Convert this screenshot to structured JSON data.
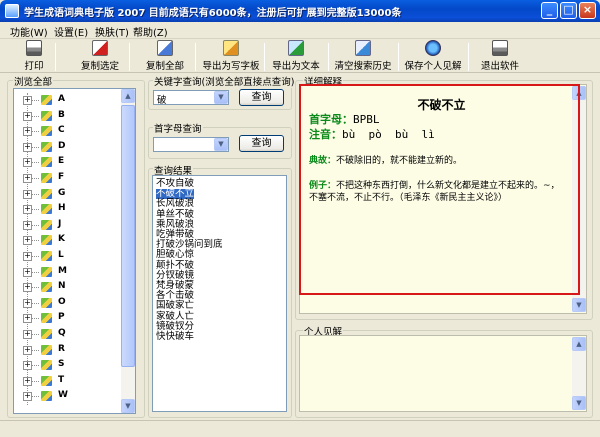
{
  "window": {
    "title": "学生成语词典电子版 2007 目前成语只有6000条，注册后可扩展到完整版13000条"
  },
  "menu": [
    "功能(W)",
    "设置(E)",
    "换肤(T)",
    "帮助(Z)"
  ],
  "toolbar": {
    "print": "打印",
    "copy_selected": "复制选定",
    "copy_all": "复制全部",
    "export_writer": "导出为写字板",
    "export_text": "导出为文本",
    "clear_history": "清空搜索历史",
    "save_opinion": "保存个人见解",
    "exit": "退出软件"
  },
  "browse": {
    "label": "浏览全部",
    "letters": [
      "A",
      "B",
      "C",
      "D",
      "E",
      "F",
      "G",
      "H",
      "J",
      "K",
      "L",
      "M",
      "N",
      "O",
      "P",
      "Q",
      "R",
      "S",
      "T",
      "W"
    ]
  },
  "keyword_search": {
    "label": "关键字查询(浏览全部直接点查询)",
    "value": "破",
    "button": "查询"
  },
  "initial_search": {
    "label": "首字母查询",
    "value": "",
    "button": "查询"
  },
  "results": {
    "label": "查询结果",
    "items": [
      "不攻自破",
      "不破不立",
      "长风破浪",
      "单丝不破",
      "乘风破浪",
      "吃弹带破",
      "打破沙锅问到底",
      "胆破心惊",
      "颠扑不破",
      "分钗破镜",
      "梵身破蒙",
      "各个击破",
      "国破家亡",
      "家破人亡",
      "镜破钗分",
      "快快破车"
    ],
    "selected_index": 1
  },
  "detail": {
    "label": "详细解释",
    "idiom": "不破不立",
    "initials_label": "首字母：",
    "initials_value": "BPBL",
    "pinyin_label": "注音：",
    "pinyin_value": "bù  pò  bù  lì",
    "origin_label": "典故：",
    "origin_text": "不破除旧的，就不能建立新的。",
    "example_label": "例子：",
    "example_line1": "不把这种东西打倒，什么新文化都是建立不起来的。~，",
    "example_line2": "不塞不流，不止不行。（毛泽东《新民主主义论》）"
  },
  "opinion": {
    "label": "个人见解"
  },
  "colors": {
    "highlight_box": "#d81818",
    "label_green": "#0b8a1a",
    "selection": "#316ac5"
  }
}
